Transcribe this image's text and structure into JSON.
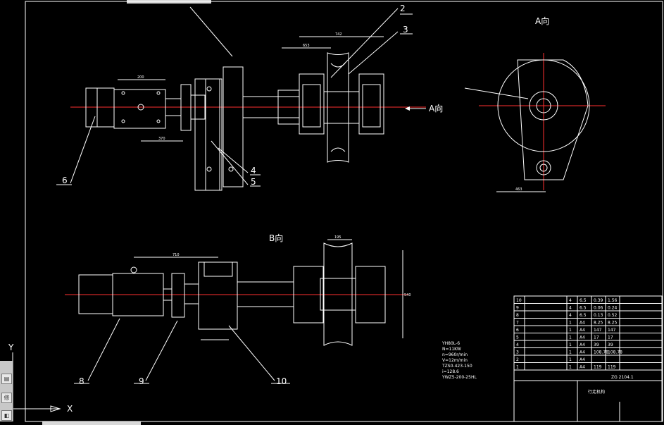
{
  "views": {
    "view_a": "A向",
    "arrow_a": "A向",
    "view_b": "B向"
  },
  "balloons": [
    "2",
    "3",
    "4",
    "5",
    "6",
    "8",
    "9",
    "10"
  ],
  "tech_specs": {
    "motor": "YH80L-6",
    "power": "N=11KW",
    "speed": "n=960r/min",
    "velocity": "V=12m/min",
    "reducer": "TZS0-423-150",
    "ratio": "i=128.6",
    "coupling": "YWZ5-200-25HL"
  },
  "parts_table": {
    "rows": [
      {
        "no": "10",
        "qty": "4",
        "mat": "6.5",
        "w1": "0.39",
        "w2": "1.56"
      },
      {
        "no": "9",
        "qty": "4",
        "mat": "6.5",
        "w1": "0.06",
        "w2": "0.24"
      },
      {
        "no": "8",
        "qty": "4",
        "mat": "6.5",
        "w1": "0.13",
        "w2": "0.52"
      },
      {
        "no": "7",
        "qty": "1",
        "mat": "A4",
        "w1": "8.25",
        "w2": "8.25"
      },
      {
        "no": "6",
        "qty": "1",
        "mat": "A4",
        "w1": "147",
        "w2": "147"
      },
      {
        "no": "5",
        "qty": "1",
        "mat": "A4",
        "w1": "17",
        "w2": "17"
      },
      {
        "no": "4",
        "qty": "1",
        "mat": "A4",
        "w1": "39",
        "w2": "39"
      },
      {
        "no": "3",
        "qty": "1",
        "mat": "A4",
        "w1": "108.78",
        "w2": "108.78"
      },
      {
        "no": "2",
        "qty": "1",
        "mat": "A4",
        "w1": "",
        "w2": ""
      },
      {
        "no": "1",
        "qty": "1",
        "mat": "A4",
        "w1": "119",
        "w2": "119"
      }
    ],
    "drawing_no": "ZG 2104.1",
    "title_block_name": "行走机构"
  },
  "axes": {
    "y_label": "Y",
    "x_label": "X"
  },
  "dimensions": {
    "d742": "742",
    "d653": "653",
    "d200": "200",
    "d370": "370",
    "d463": "463",
    "d710": "710",
    "d195": "195",
    "d540": "540"
  },
  "toolbar": {
    "btn1": "▤",
    "btn2": "修",
    "btn3": "◧"
  }
}
